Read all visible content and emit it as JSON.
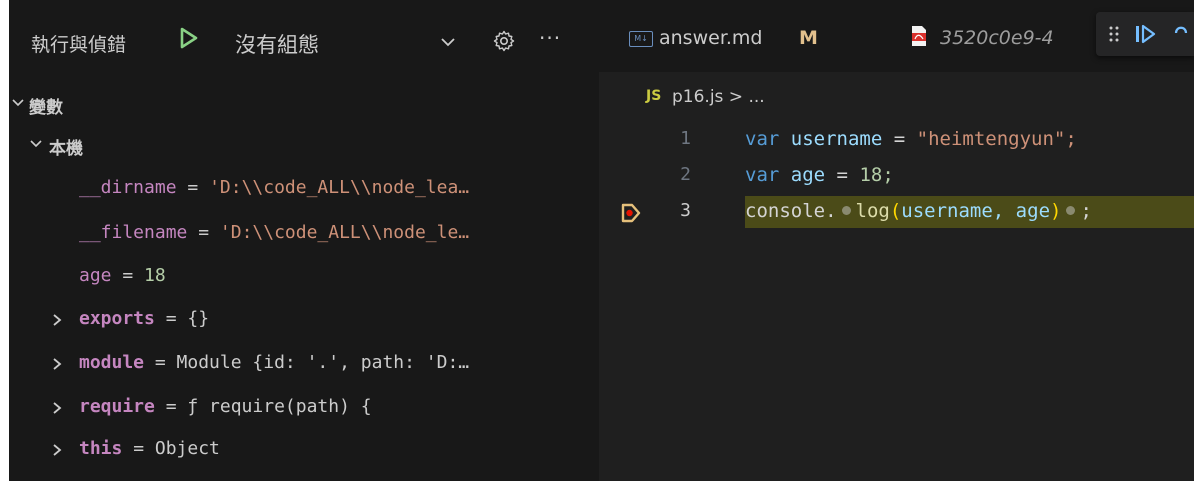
{
  "debug": {
    "title": "執行與偵錯",
    "config_label": "沒有組態",
    "more_label": "···"
  },
  "variables": {
    "section_label": "變數",
    "scope_label": "本機",
    "items": [
      {
        "name": "__dirname",
        "eq": " = ",
        "value": "'D:\\\\code_ALL\\\\node_lea…"
      },
      {
        "name": "__filename",
        "eq": " = ",
        "value": "'D:\\\\code_ALL\\\\node_le…"
      },
      {
        "name": "age",
        "eq": " = ",
        "value": "18"
      },
      {
        "name": "exports",
        "eq": " = ",
        "value": "{}"
      },
      {
        "name": "module",
        "eq": " = ",
        "value": "Module {id: '.', path: 'D:…"
      },
      {
        "name": "require",
        "eq": " = ",
        "value": "ƒ require(path) {"
      },
      {
        "name": "this",
        "eq": " = ",
        "value": "Object"
      }
    ]
  },
  "tabs": [
    {
      "icon": "markdown-icon",
      "icon_text": "M↓",
      "label": "answer.md",
      "modified": "M"
    },
    {
      "icon": "pdf-icon",
      "label": "3520c0e9-4"
    }
  ],
  "breadcrumb": {
    "badge": "JS",
    "path": "p16.js > ..."
  },
  "code": {
    "lines": [
      {
        "num": "1",
        "kw": "var",
        "id": "username",
        "op": " = ",
        "val": "\"heimtengyun\";"
      },
      {
        "num": "2",
        "kw": "var",
        "id": "age",
        "op": " = ",
        "val": "18;"
      },
      {
        "num": "3",
        "obj": "console.",
        "fn": "log",
        "open": "(",
        "args": "username, age",
        "close": ")",
        "tail": ";"
      }
    ]
  },
  "colors": {
    "accent_debug": "#e5c07b",
    "play_green": "#89d185",
    "current_line": "#4b4b18"
  }
}
